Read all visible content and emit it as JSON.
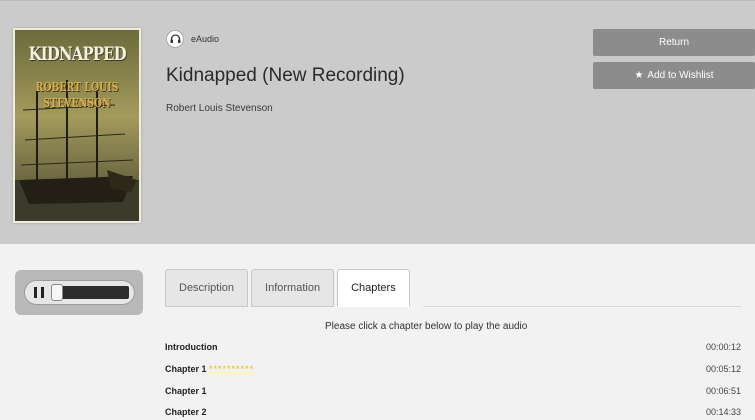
{
  "cover": {
    "title": "KIDNAPPED",
    "author_line1": "ROBERT LOUIS",
    "author_line2": "STEVENSON"
  },
  "format": {
    "label": "eAudio",
    "icon": "headphones-icon"
  },
  "book": {
    "title": "Kidnapped (New Recording)",
    "author": "Robert Louis Stevenson"
  },
  "actions": {
    "return_label": "Return",
    "wishlist_label": "Add to Wishlist",
    "wishlist_icon": "star-icon"
  },
  "player": {
    "pause_icon": "pause-icon",
    "progress": 0.0
  },
  "tabs": [
    {
      "label": "Description",
      "active": false
    },
    {
      "label": "Information",
      "active": false
    },
    {
      "label": "Chapters",
      "active": true
    }
  ],
  "instruction": "Please click a chapter below to play the audio",
  "chapters": [
    {
      "name": "Introduction",
      "marker": "",
      "time": "00:00:12"
    },
    {
      "name": "Chapter 1",
      "marker": "**********",
      "time": "00:05:12"
    },
    {
      "name": "Chapter 1",
      "marker": "",
      "time": "00:06:51"
    },
    {
      "name": "Chapter 2",
      "marker": "",
      "time": "00:14:33"
    }
  ],
  "colors": {
    "header_bg": "#cbcbcb",
    "button_bg": "#8c8c8c",
    "page_bg": "#f2f2f2",
    "highlight": "#e0c000"
  }
}
